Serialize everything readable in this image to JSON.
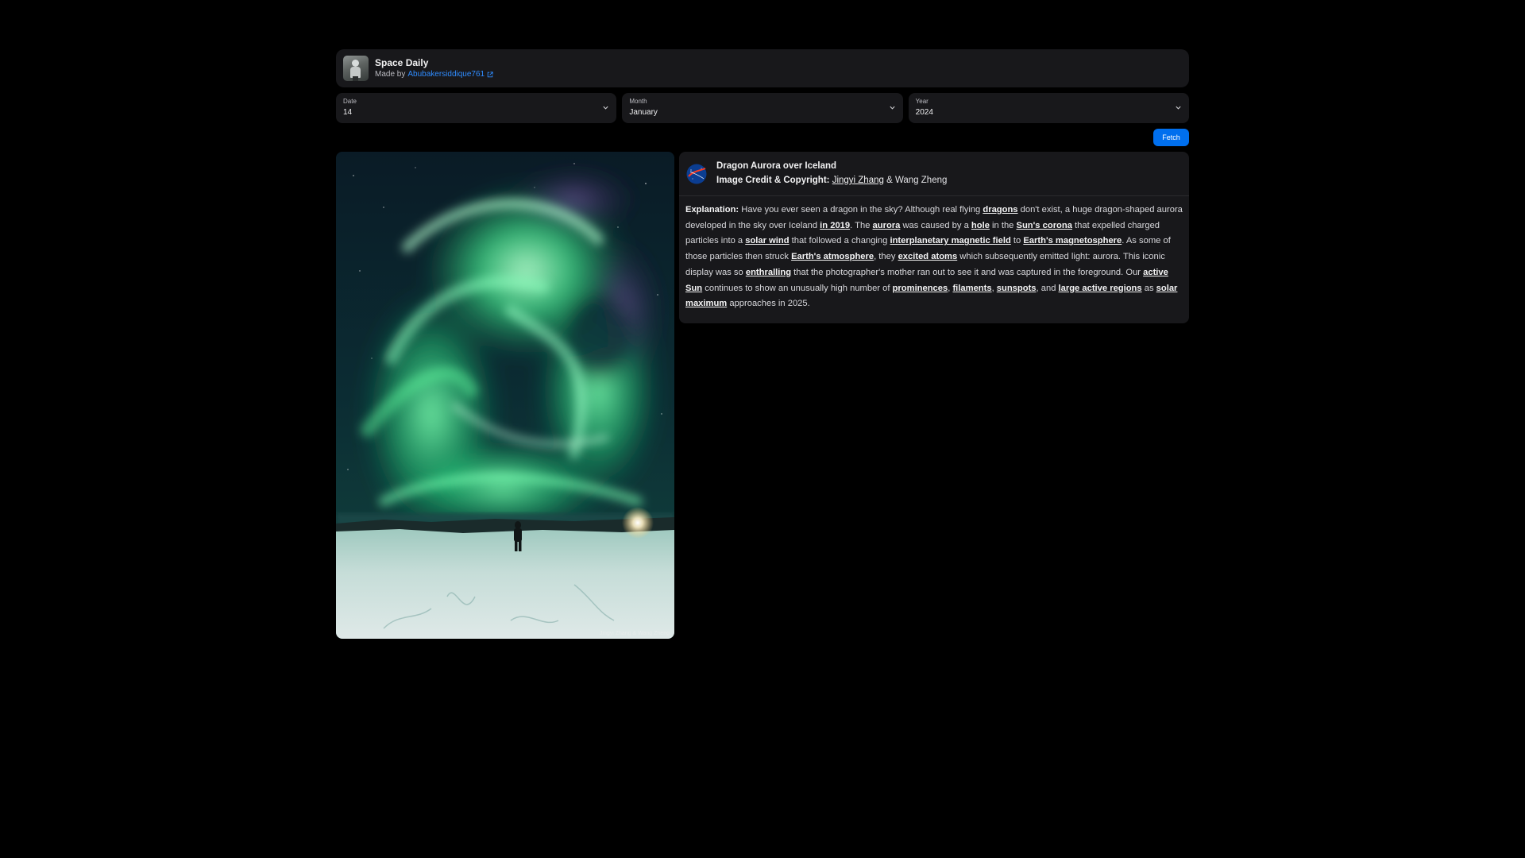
{
  "header": {
    "title": "Space Daily",
    "made_by_prefix": "Made by",
    "author": "Abubakersiddique761"
  },
  "selects": {
    "date": {
      "label": "Date",
      "value": "14"
    },
    "month": {
      "label": "Month",
      "value": "January"
    },
    "year": {
      "label": "Year",
      "value": "2024"
    }
  },
  "fetch_label": "Fetch",
  "image": {
    "watermark": "Jingyi Zhang & Wang Zheng"
  },
  "apod": {
    "title": "Dragon Aurora over Iceland",
    "credit_label": "Image Credit & Copyright:",
    "credit_link": "Jingyi Zhang",
    "credit_rest": " & Wang Zheng",
    "explanation_label": "Explanation:",
    "explanation": [
      {
        "t": " Have you ever seen a dragon in the sky? Although real flying "
      },
      {
        "t": "dragons",
        "link": true
      },
      {
        "t": " don't exist, a huge dragon-shaped aurora developed in the sky over Iceland "
      },
      {
        "t": "in 2019",
        "link": true
      },
      {
        "t": ". The "
      },
      {
        "t": "aurora",
        "link": true
      },
      {
        "t": " was caused by a "
      },
      {
        "t": "hole",
        "link": true
      },
      {
        "t": " in the "
      },
      {
        "t": "Sun's corona",
        "link": true
      },
      {
        "t": " that expelled charged particles into a "
      },
      {
        "t": "solar wind",
        "link": true
      },
      {
        "t": " that followed a changing "
      },
      {
        "t": "interplanetary magnetic field",
        "link": true
      },
      {
        "t": " to "
      },
      {
        "t": "Earth's magnetosphere",
        "link": true
      },
      {
        "t": ". As some of those particles then struck "
      },
      {
        "t": "Earth's atmosphere",
        "link": true
      },
      {
        "t": ", they "
      },
      {
        "t": "excited atoms",
        "link": true
      },
      {
        "t": " which subsequently emitted light: aurora. This iconic display was so "
      },
      {
        "t": "enthralling",
        "link": true
      },
      {
        "t": " that the photographer's mother ran out to see it and was captured in the foreground. Our "
      },
      {
        "t": "active Sun",
        "link": true
      },
      {
        "t": " continues to show an unusually high number of "
      },
      {
        "t": "prominences",
        "link": true
      },
      {
        "t": ", "
      },
      {
        "t": "filaments",
        "link": true
      },
      {
        "t": ", "
      },
      {
        "t": "sunspots",
        "link": true
      },
      {
        "t": ", and "
      },
      {
        "t": "large active regions",
        "link": true
      },
      {
        "t": " as "
      },
      {
        "t": "solar maximum",
        "link": true
      },
      {
        "t": " approaches in 2025."
      }
    ]
  },
  "colors": {
    "accent": "#006fee",
    "link": "#2f8cff",
    "card": "#18181b",
    "background": "#000000"
  }
}
